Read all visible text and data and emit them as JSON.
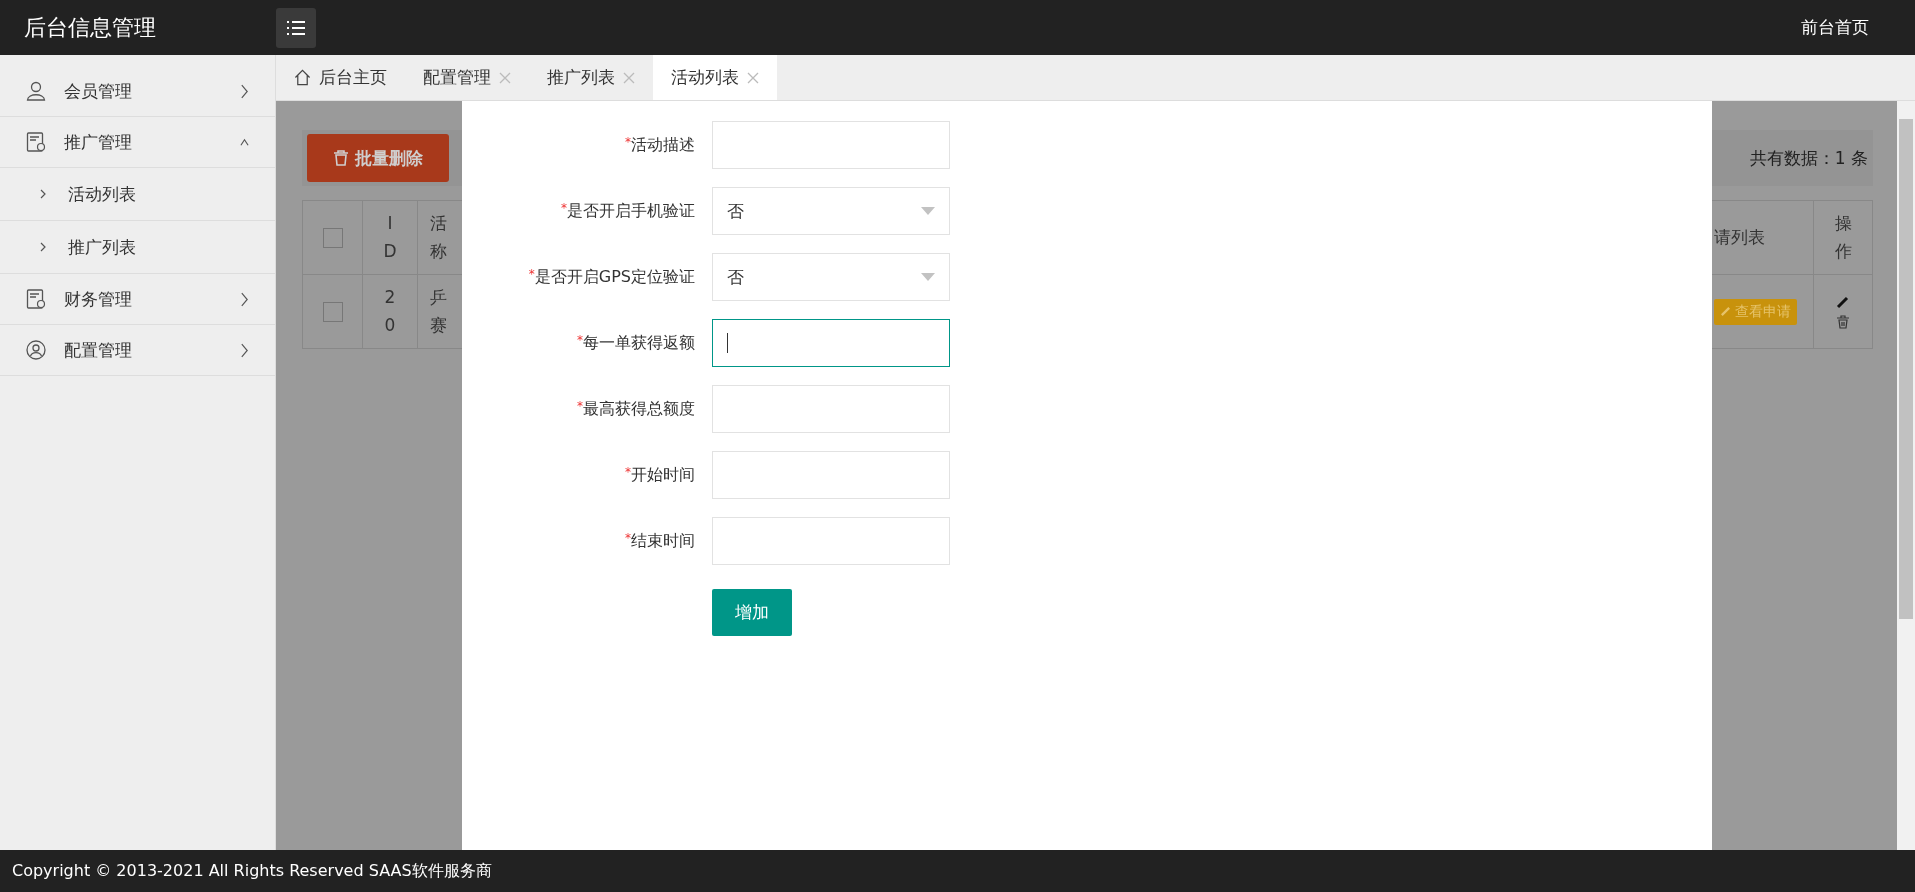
{
  "header": {
    "title": "后台信息管理",
    "front_link": "前台首页"
  },
  "sidebar": {
    "items": [
      {
        "label": "会员管理",
        "expanded": false
      },
      {
        "label": "推广管理",
        "expanded": true,
        "children": [
          {
            "label": "活动列表"
          },
          {
            "label": "推广列表"
          }
        ]
      },
      {
        "label": "财务管理",
        "expanded": false
      },
      {
        "label": "配置管理",
        "expanded": false
      }
    ]
  },
  "tabs": [
    {
      "label": "后台主页",
      "kind": "home",
      "selected": false
    },
    {
      "label": "配置管理",
      "kind": "closable",
      "selected": false
    },
    {
      "label": "推广列表",
      "kind": "closable",
      "selected": false
    },
    {
      "label": "活动列表",
      "kind": "closable",
      "selected": true
    }
  ],
  "toolbar": {
    "delete_button": "批量删除",
    "total": "共有数据：1 条"
  },
  "table": {
    "header": {
      "checked": false,
      "id": "ID",
      "column_3": "活称",
      "column_4": "请列表",
      "actions": "操作"
    },
    "rows": [
      {
        "checked": false,
        "id": "20",
        "column_3": "乒赛",
        "badge": "查看申请"
      }
    ]
  },
  "form": {
    "required_mark": "*",
    "fields": [
      {
        "label": "活动描述",
        "kind": "input",
        "required": true,
        "focused": false
      },
      {
        "label": "是否开启手机验证",
        "kind": "select",
        "value": "否",
        "required": true,
        "focused": false
      },
      {
        "label": "是否开启GPS定位验证",
        "kind": "select",
        "value": "否",
        "required": true,
        "focused": false
      },
      {
        "label": "每一单获得返额",
        "kind": "input",
        "required": true,
        "focused": true
      },
      {
        "label": "最高获得总额度",
        "kind": "input",
        "required": true,
        "focused": false
      },
      {
        "label": "开始时间",
        "kind": "input",
        "required": true,
        "focused": false
      },
      {
        "label": "结束时间",
        "kind": "input",
        "required": true,
        "focused": false
      }
    ],
    "submit": "增加"
  },
  "footer": "Copyright © 2013-2021 All Rights Reserved SAAS软件服务商"
}
